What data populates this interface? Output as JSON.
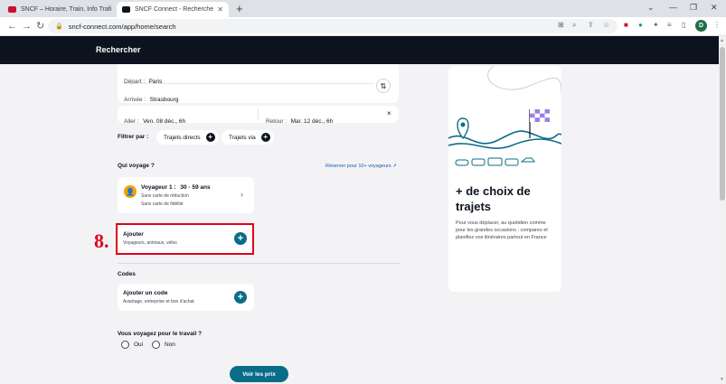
{
  "browser": {
    "tabs": [
      {
        "label": "SNCF – Horaire, Train, Info Trafi",
        "favicon_color": "#c8102e"
      },
      {
        "label": "SNCF Connect - Recherche",
        "favicon_color": "#0c131f"
      }
    ],
    "new_tab": "+",
    "url": "sncf-connect.com/app/home/search",
    "profile_initial": "D"
  },
  "header": {
    "title": "Rechercher"
  },
  "search": {
    "depart_label": "Départ :",
    "depart_value": "Paris",
    "arrivee_label": "Arrivée :",
    "arrivee_value": "Strasbourg",
    "aller_label": "Aller :",
    "aller_value": "Ven. 08 déc., 6h",
    "retour_label": "Retour :",
    "retour_value": "Mar. 12 déc., 6h",
    "clear": "×",
    "swap": "⇅"
  },
  "filters": {
    "label": "Filtrer par :",
    "chips": [
      "Trajets directs",
      "Trajets via"
    ]
  },
  "travelers": {
    "section_label": "Qui voyage ?",
    "reserve_link": "Réserver pour 10+ voyageurs",
    "traveler_title": "Voyageur 1 :",
    "traveler_age": "30 - 59 ans",
    "traveler_card1": "Sans carte de réduction",
    "traveler_card2": "Sans carte de fidélité",
    "add_title": "Ajouter",
    "add_subtitle": "Voyageurs, animaux, vélos"
  },
  "annotation": {
    "number": "8."
  },
  "codes": {
    "section_label": "Codes",
    "add_code_title": "Ajouter un code",
    "add_code_subtitle": "Avantage, entreprise et bon d'achat"
  },
  "work": {
    "question": "Vous voyagez pour le travail ?",
    "options": [
      "Oui",
      "Non"
    ]
  },
  "cta": {
    "label": "Voir les prix"
  },
  "promo": {
    "headline": "+ de choix de trajets",
    "body": "Pour vous déplacer, au quotidien comme pour les grandes occasions : comparez et planifiez vos itinéraires partout en France"
  },
  "colors": {
    "header_bg": "#0c131f",
    "accent_teal": "#0a6d88",
    "annotation_red": "#e2001a",
    "promo_purple": "#9b7fe6"
  }
}
